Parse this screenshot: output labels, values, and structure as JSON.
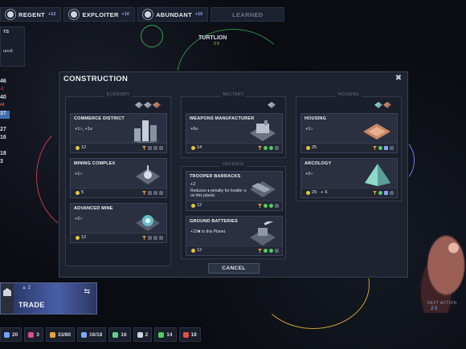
{
  "top_bar": {
    "items": [
      {
        "label": "REGENT",
        "badge": "+12",
        "mini": ""
      },
      {
        "label": "EXPLOITER",
        "badge": "+10",
        "mini": ""
      },
      {
        "label": "ABUNDANT",
        "badge": "+10",
        "mini": ""
      },
      {
        "label": "LEARNED",
        "badge": "",
        "mini": ""
      }
    ]
  },
  "left_panel": {
    "title": "TS",
    "line": "uncil:"
  },
  "left_numbers": [
    "46",
    "-1",
    "40",
    "44",
    "37",
    "",
    "27",
    "16",
    "",
    "18",
    "3"
  ],
  "map": {
    "planet_name": "TURTLION",
    "planet_sub": "2 0"
  },
  "dialog": {
    "title": "CONSTRUCTION",
    "cancel_label": "CANCEL",
    "columns": {
      "economy": {
        "title": "ECONOMY"
      },
      "military": {
        "title": "MILITARY"
      },
      "housing": {
        "title": "HOUSING"
      },
      "defence": {
        "title": "DEFENCE"
      }
    },
    "cards": {
      "commerce": {
        "name": "COMMERCE DISTRICT",
        "yield": "+1○, +1≡",
        "cost": "12"
      },
      "mining": {
        "name": "MINING COMPLEX",
        "yield": "+1○",
        "cost": "5"
      },
      "advanced_mine": {
        "name": "ADVANCED MINE",
        "yield": "+2○",
        "cost": "12"
      },
      "weapons": {
        "name": "WEAPONS MANUFACTURER",
        "yield": "+6≡",
        "cost": "14"
      },
      "barracks": {
        "name": "TROOPER BARRACKS",
        "yield": "+2",
        "desc": "Reduces ♦ penalty for hostile ☠ on this planet.",
        "cost": "12"
      },
      "ground_batteries": {
        "name": "GROUND BATTERIES",
        "yield": "+10✖ to this Planet.",
        "cost": "12"
      },
      "housing": {
        "name": "HOUSING",
        "yield": "+1○",
        "cost": "25"
      },
      "arcology": {
        "name": "ARCOLOGY",
        "yield": "+2○",
        "cost": "29",
        "cost2": "6"
      }
    }
  },
  "trade": {
    "label": "TRADE",
    "count": "2"
  },
  "bottom_bar": [
    {
      "value": "20",
      "color": "#6fa3ff"
    },
    {
      "value": "3",
      "color": "#e04c8f"
    },
    {
      "value": "33/80",
      "color": "#e3a63a"
    },
    {
      "value": "16/18",
      "color": "#7fa6ff"
    },
    {
      "value": "16",
      "color": "#5fd38a"
    },
    {
      "value": "2",
      "color": "#cfd5de"
    },
    {
      "value": "14",
      "color": "#4fce5e"
    },
    {
      "value": "18",
      "color": "#e84d4d"
    }
  ],
  "next_action": {
    "label": "NEXT ACTION",
    "sub": "2 0"
  }
}
